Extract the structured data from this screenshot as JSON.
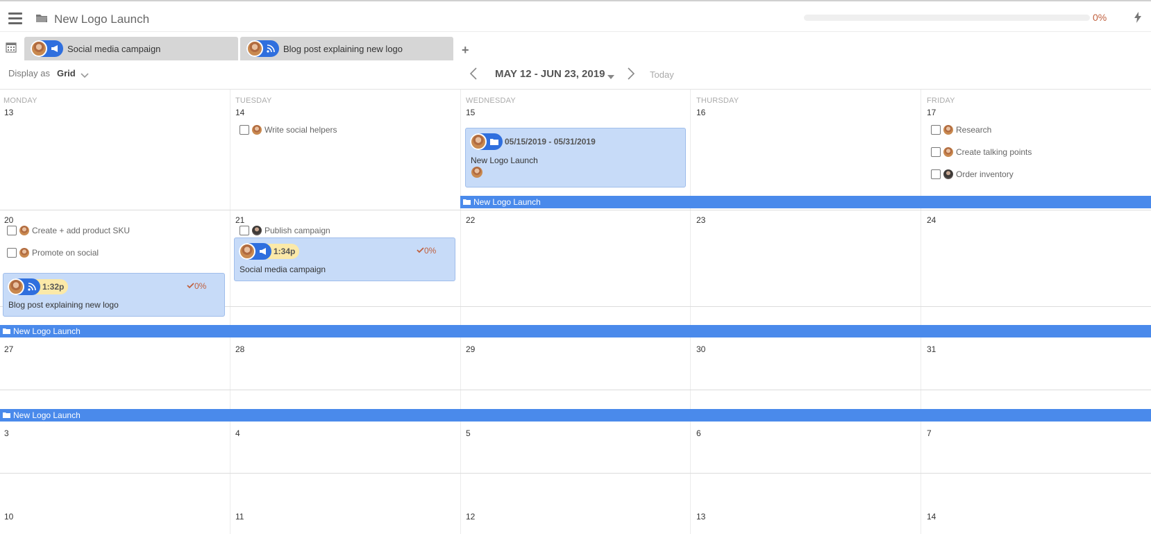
{
  "header": {
    "title": "New Logo Launch",
    "progress_label": "0%",
    "progress_value": 0
  },
  "tabs": [
    {
      "label": "Social media campaign",
      "icon": "megaphone-icon"
    },
    {
      "label": "Blog post explaining new logo",
      "icon": "rss-icon"
    }
  ],
  "toolbar": {
    "display_as": "Display as",
    "view": "Grid",
    "range": "MAY 12 - JUN 23, 2019",
    "today": "Today"
  },
  "days": [
    "MONDAY",
    "TUESDAY",
    "WEDNESDAY",
    "THURSDAY",
    "FRIDAY"
  ],
  "weeks": [
    [
      "13",
      "14",
      "15",
      "16",
      "17"
    ],
    [
      "20",
      "21",
      "22",
      "23",
      "24"
    ],
    [
      "27",
      "28",
      "29",
      "30",
      "31"
    ],
    [
      "3",
      "4",
      "5",
      "6",
      "7"
    ],
    [
      "10",
      "11",
      "12",
      "13",
      "14"
    ]
  ],
  "tasks": {
    "write_social_helpers": "Write social helpers",
    "research": "Research",
    "create_talking_points": "Create talking points",
    "order_inventory": "Order inventory",
    "create_add_sku": "Create + add product SKU",
    "promote_on_social": "Promote on social",
    "publish_campaign": "Publish campaign"
  },
  "cards": {
    "project": {
      "range": "05/15/2019 - 05/31/2019",
      "title": "New Logo Launch"
    },
    "blog": {
      "time": "1:32p",
      "pct": "0%",
      "title": "Blog post explaining new logo"
    },
    "social": {
      "time": "1:34p",
      "pct": "0%",
      "title": "Social media campaign"
    }
  },
  "project_bar": {
    "label": "New Logo Launch",
    "color": "#4a8aeb"
  },
  "colors": {
    "accent": "#2f6fde",
    "card_bg": "#c7dbf8",
    "time_pill": "#fbe9a8",
    "pct": "#c0603e"
  }
}
